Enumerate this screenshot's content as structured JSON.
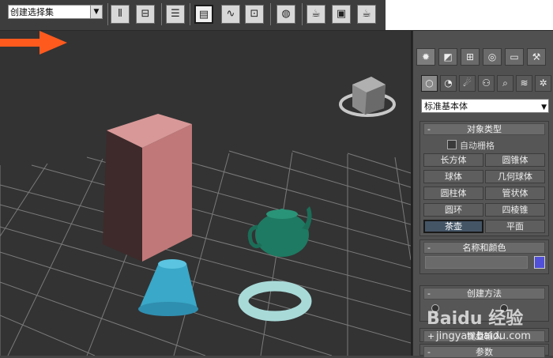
{
  "toolbar": {
    "selection_set": "创建选择集",
    "buttons": [
      "mirror-icon",
      "align-icon",
      "layer-manager-icon",
      "scene-explorer-icon",
      "curve-editor-icon",
      "schematic-view-icon",
      "material-editor-icon",
      "render-setup-icon",
      "rendered-frame-icon",
      "render-production-icon"
    ]
  },
  "panel": {
    "category_dropdown": "标准基本体",
    "object_type": {
      "title": "对象类型",
      "autogrid": "自动栅格",
      "buttons": [
        "长方体",
        "圆锥体",
        "球体",
        "几何球体",
        "圆柱体",
        "管状体",
        "圆环",
        "四棱锥",
        "茶壶",
        "平面"
      ],
      "selected": "茶壶"
    },
    "name_color": {
      "title": "名称和颜色",
      "swatch_color": "#5050d8"
    },
    "creation_method": {
      "title": "创建方法"
    },
    "keyboard_entry": {
      "title": "键盘输入"
    },
    "parameters": {
      "title": "参数"
    }
  },
  "watermark": {
    "brand": "Baidu 经验",
    "url": "jingyan.baidu.com"
  },
  "colors": {
    "arrow": "#ff5a1e",
    "teapot": "#1e7a62",
    "cone": "#3aa8c8",
    "torus": "#a8dad8",
    "box_front": "#7a4040",
    "box_side": "#c07878",
    "box_top": "#d89898"
  }
}
